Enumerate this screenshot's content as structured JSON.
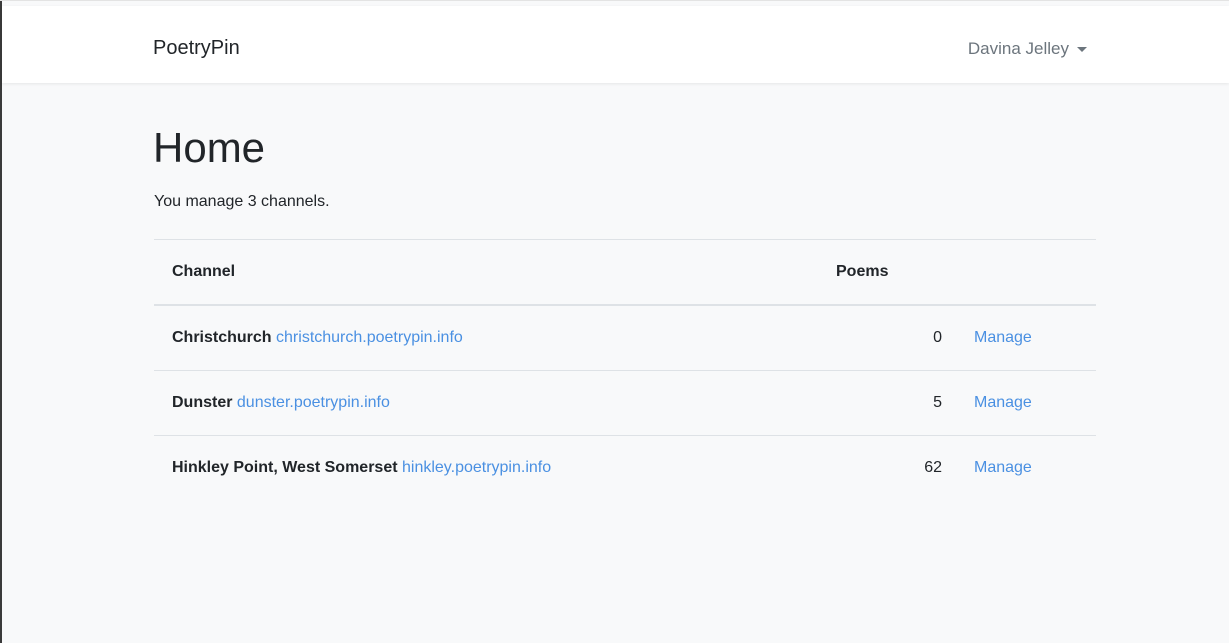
{
  "navbar": {
    "brand": "PoetryPin",
    "user_name": "Davina Jelley"
  },
  "main": {
    "title": "Home",
    "summary": "You manage 3 channels.",
    "table": {
      "headers": {
        "channel": "Channel",
        "poems": "Poems",
        "action": ""
      },
      "rows": [
        {
          "name": "Christchurch",
          "domain": "christchurch.poetrypin.info",
          "poems": "0",
          "action": "Manage"
        },
        {
          "name": "Dunster",
          "domain": "dunster.poetrypin.info",
          "poems": "5",
          "action": "Manage"
        },
        {
          "name": "Hinkley Point, West Somerset",
          "domain": "hinkley.poetrypin.info",
          "poems": "62",
          "action": "Manage"
        }
      ]
    }
  },
  "colors": {
    "page_background": "#f8f9fa",
    "navbar_background": "#ffffff",
    "link": "#4a90e2",
    "muted_text": "#6c757d",
    "body_text": "#212529",
    "divider": "#dee2e6"
  },
  "icons": {
    "user_menu_caret": "caret-down-icon"
  }
}
